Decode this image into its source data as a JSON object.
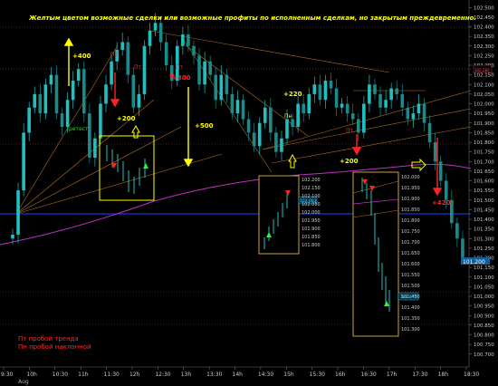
{
  "annotation_note": "Желтым цветом возможные сделки или возможные профиты по исполненным сделкам, но закрытым преждевременно.",
  "legend": {
    "pt": "Пт пробой тренда",
    "pn": "Пн пробой наклонной"
  },
  "colors": {
    "background": "#000000",
    "candle_up": "#20c0c0",
    "candle_down": "#1a8a8a",
    "annotation": "#ffff00",
    "signal_red": "#ff2222",
    "moving_average": "#c030c0",
    "support_line": "#1e3fff",
    "fib_lines": "#b07020"
  },
  "chart_data": {
    "type": "candlestick",
    "instrument_note": "intraday Aug",
    "date_label": "Aug",
    "x_ticks": [
      "9:30",
      "10h",
      "10:30",
      "11h",
      "11:30",
      "12h",
      "12:30",
      "13h",
      "13:30",
      "14h",
      "14:30",
      "15h",
      "15:30",
      "16h",
      "16:30",
      "17h",
      "17:30",
      "18h",
      "18:30"
    ],
    "y_ticks": [
      "102.500",
      "102.450",
      "102.400",
      "102.350",
      "102.300",
      "102.250",
      "102.200",
      "102.150",
      "102.100",
      "102.050",
      "102.000",
      "101.950",
      "101.900",
      "101.850",
      "101.800",
      "101.750",
      "101.700",
      "101.650",
      "101.600",
      "101.550",
      "101.500",
      "101.450",
      "101.400",
      "101.350",
      "101.300",
      "101.250",
      "101.200",
      "101.150",
      "101.100",
      "101.050",
      "101.000",
      "100.950",
      "100.900",
      "100.850",
      "100.800",
      "100.750",
      "100.700"
    ],
    "ylim": [
      100.68,
      102.52
    ],
    "last_price": "101.200",
    "marked_level": "102.283",
    "closes": [
      101.32,
      101.55,
      101.85,
      101.98,
      102.05,
      101.95,
      102.1,
      102.15,
      101.95,
      101.88,
      102.02,
      102.12,
      102.18,
      101.95,
      101.72,
      101.82,
      102.0,
      102.1,
      102.22,
      102.28,
      102.32,
      102.15,
      101.98,
      102.05,
      102.3,
      102.38,
      102.42,
      102.32,
      102.2,
      102.12,
      102.3,
      102.36,
      102.3,
      102.25,
      102.1,
      102.22,
      102.15,
      102.02,
      102.15,
      102.05,
      101.95,
      102.02,
      101.92,
      101.85,
      101.78,
      101.9,
      101.98,
      101.85,
      101.75,
      101.82,
      101.92,
      101.88,
      102.0,
      101.95,
      102.05,
      102.1,
      102.02,
      102.12,
      102.08,
      101.98,
      102.0,
      101.95,
      101.92,
      101.85,
      102.0,
      102.1,
      102.05,
      101.98,
      102.02,
      102.08,
      102.05,
      101.98,
      101.92,
      101.95,
      102.0,
      101.9,
      101.8,
      101.7,
      101.6,
      101.5,
      101.38,
      101.3,
      101.2
    ],
    "overlays": [
      "moving_average",
      "fib_fan",
      "support_line",
      "trend_lines"
    ],
    "annotations": [
      "+400",
      "+200",
      "+500",
      "+300",
      "+220",
      "+200",
      "+420",
      "ретест",
      "Пт",
      "Пт",
      "Пт",
      "Пн",
      "Пт"
    ],
    "inset1_ticks": [
      "102.200",
      "102.150",
      "102.100",
      "102.050",
      "102.000",
      "101.950",
      "101.900",
      "101.850",
      "101.800"
    ],
    "inset2_ticks": [
      "102.000",
      "101.950",
      "101.900",
      "101.850",
      "101.800",
      "101.750",
      "101.700",
      "101.650",
      "101.600",
      "101.550",
      "101.500",
      "101.450",
      "101.400",
      "101.350",
      "101.300"
    ],
    "inset1_marker": "102.083",
    "inset2_marker": "101.470"
  }
}
